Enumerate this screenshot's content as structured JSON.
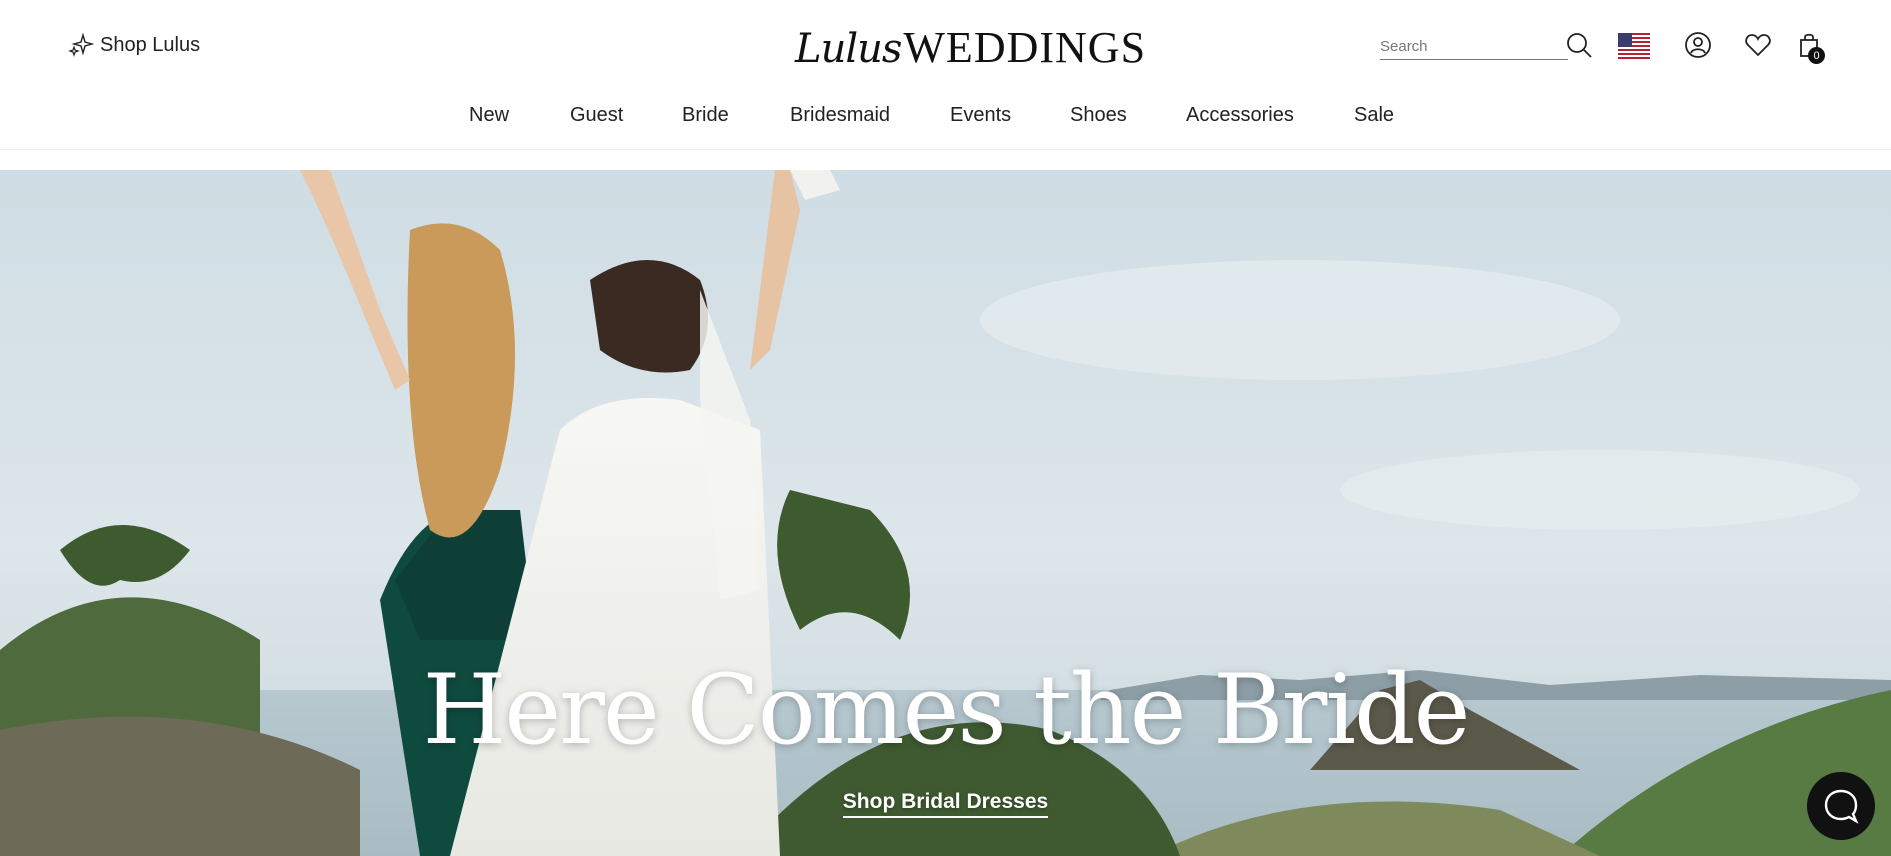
{
  "header": {
    "shop_link": "Shop Lulus",
    "logo_script": "Lulus",
    "logo_word": "WEDDINGS",
    "search_placeholder": "Search",
    "bag_count": "0"
  },
  "nav": {
    "items": [
      {
        "label": "New"
      },
      {
        "label": "Guest"
      },
      {
        "label": "Bride"
      },
      {
        "label": "Bridesmaid"
      },
      {
        "label": "Events"
      },
      {
        "label": "Shoes"
      },
      {
        "label": "Accessories"
      },
      {
        "label": "Sale"
      }
    ]
  },
  "hero": {
    "title": "Here Comes the Bride",
    "cta": "Shop Bridal Dresses"
  },
  "icons": {
    "shop": "sparkle-icon",
    "search": "search-icon",
    "flag": "us-flag-icon",
    "account": "account-icon",
    "wishlist": "heart-icon",
    "bag": "shopping-bag-icon",
    "chat": "chat-icon"
  }
}
